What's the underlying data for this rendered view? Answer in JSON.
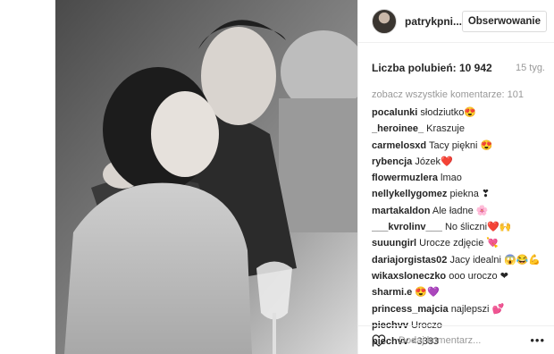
{
  "post": {
    "username": "patrykpni...",
    "follow_label": "Obserwowanie",
    "likes_text": "Liczba polubień: 10 942",
    "time_ago": "15 tyg.",
    "view_all_comments": "zobacz wszystkie komentarze: 101",
    "comment_placeholder": "Dodaj komentarz...",
    "more_icon": "•••"
  },
  "comments": [
    {
      "user": "pocalunki",
      "text": "słodziutko😍"
    },
    {
      "user": "_heroinee_",
      "text": "Kraszuje"
    },
    {
      "user": "carmelosxd",
      "text": "Tacy piękni 😍"
    },
    {
      "user": "rybencja",
      "text": "Józek❤️"
    },
    {
      "user": "flowermuzlera",
      "text": "lmao"
    },
    {
      "user": "nellykellygomez",
      "text": "piekna ❣"
    },
    {
      "user": "martakaldon",
      "text": "Ale ładne 🌸"
    },
    {
      "user": "___kvrolinv___",
      "text": "No śliczni❤️🙌"
    },
    {
      "user": "suuungirl",
      "text": "Urocze zdjęcie 💘"
    },
    {
      "user": "dariajorgistas02",
      "text": "Jacy idealni 😱😂💪"
    },
    {
      "user": "wikaxsloneczko",
      "text": "ooo uroczo ❤"
    },
    {
      "user": "sharmi.e",
      "text": "😍💜"
    },
    {
      "user": "princess_majcia",
      "text": "najlepszi 💕"
    },
    {
      "user": "piechvv",
      "text": "Uroczo"
    },
    {
      "user": "piechvv",
      "text": "<3333"
    }
  ]
}
